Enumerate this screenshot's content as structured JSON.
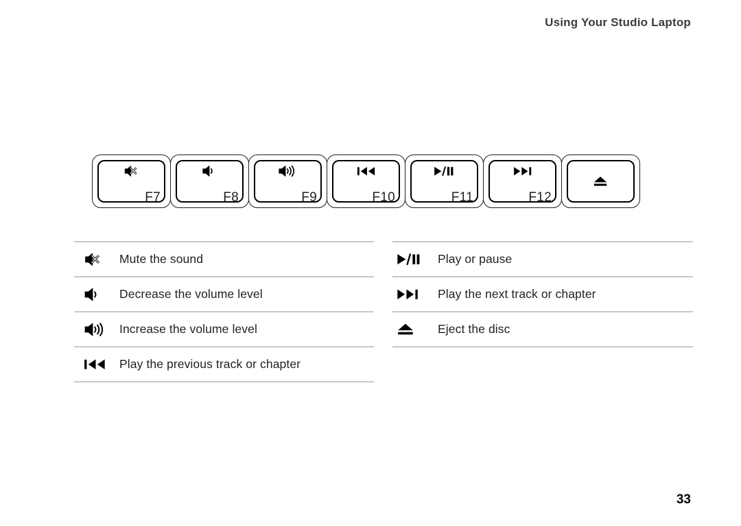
{
  "header": {
    "title": "Using Your Studio Laptop"
  },
  "keyboard": {
    "keys": [
      {
        "icon": "mute-icon",
        "label": "F7"
      },
      {
        "icon": "volume-down-icon",
        "label": "F8"
      },
      {
        "icon": "volume-up-icon",
        "label": "F9"
      },
      {
        "icon": "previous-track-icon",
        "label": "F10"
      },
      {
        "icon": "play-pause-icon",
        "label": "F11"
      },
      {
        "icon": "next-track-icon",
        "label": "F12"
      },
      {
        "icon": "eject-icon",
        "label": ""
      }
    ]
  },
  "legend": {
    "left": [
      {
        "icon": "mute-icon",
        "description": "Mute the sound"
      },
      {
        "icon": "volume-down-icon",
        "description": "Decrease the volume level"
      },
      {
        "icon": "volume-up-icon",
        "description": "Increase the volume level"
      },
      {
        "icon": "previous-track-icon",
        "description": "Play the previous track or chapter"
      }
    ],
    "right": [
      {
        "icon": "play-pause-icon",
        "description": "Play or pause"
      },
      {
        "icon": "next-track-icon",
        "description": "Play the next track or chapter"
      },
      {
        "icon": "eject-icon",
        "description": "Eject the disc"
      }
    ]
  },
  "footer": {
    "page_number": "33"
  },
  "colors": {
    "text": "#231f20",
    "header_text": "#3c3c3c",
    "rule": "#c9c9c9",
    "key_border": "#000000",
    "background": "#ffffff"
  }
}
